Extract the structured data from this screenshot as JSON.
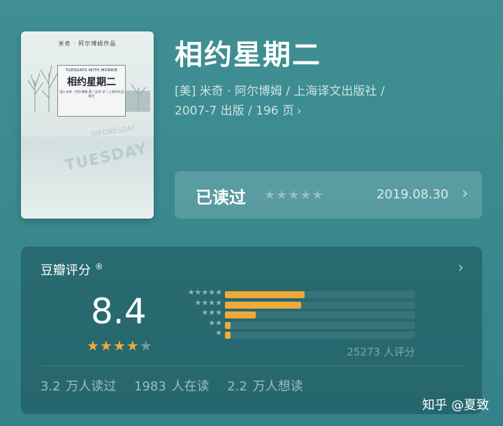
{
  "book": {
    "title": "相约星期二",
    "meta_line1": "[美] 米奇 · 阿尔博姆 / 上海译文出版社 /",
    "meta_line2": "2007-7 出版 / 196 页",
    "chevron": "›"
  },
  "cover": {
    "top_text": "米奇 · 阿尔博姆作品",
    "label_en": "TUESDAYS WITH MORRIE",
    "label_zh": "相约星期二",
    "label_small": "[美] 米奇 · 阿尔博姆 著 / 吴洪 译 / 上海译文出版社",
    "snow_text": "TUESDAY",
    "snow_text2": "WEDNESDAY"
  },
  "read_status": {
    "label": "已读过",
    "stars": "★★★★★",
    "my_rating": 0,
    "date": "2019.08.30",
    "chevron": "›"
  },
  "rating": {
    "title": "豆瓣评分",
    "mark": "®",
    "chevron": "›",
    "score": "8.4",
    "score_stars_on": "★★★★",
    "score_stars_off": "★",
    "distribution": [
      {
        "stars": "★★★★★",
        "percent": 42
      },
      {
        "stars": "★★★★",
        "percent": 40
      },
      {
        "stars": "★★★",
        "percent": 16
      },
      {
        "stars": "★★",
        "percent": 3
      },
      {
        "stars": "★",
        "percent": 3
      }
    ],
    "count_text": "25273 人评分",
    "stats": {
      "read": "3.2 万人读过",
      "reading": "1983 人在读",
      "want": "2.2 万人想读"
    }
  },
  "colors": {
    "accent": "#f1a93a",
    "background": "#3f8f94"
  },
  "watermark": "知乎 @夏致"
}
